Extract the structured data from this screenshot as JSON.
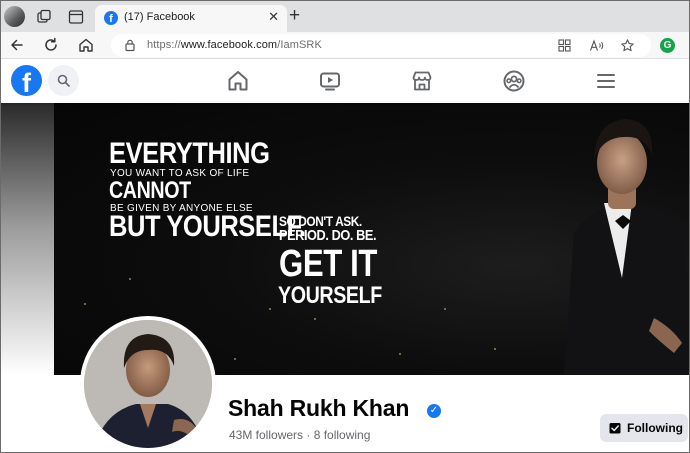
{
  "browser": {
    "tab": {
      "title": "(17) Facebook",
      "favicon": "f",
      "close": "✕"
    },
    "new_tab": "+",
    "address": {
      "url_prefix": "https://",
      "url_host": "www.facebook.com",
      "url_path": "/IamSRK"
    },
    "extension_badge": "G"
  },
  "facebook": {
    "logo": "f",
    "nav_icons": [
      "home-icon",
      "watch-icon",
      "marketplace-icon",
      "groups-icon",
      "menu-icon"
    ]
  },
  "cover": {
    "lines": {
      "l1": "EVERYTHING",
      "l2": "YOU WANT TO ASK OF LIFE",
      "l3": "CANNOT",
      "l4": "BE GIVEN BY ANYONE ELSE",
      "l5": "BUT YOURSELF.",
      "l6": "SO DON'T ASK.",
      "l7": "PERIOD. DO. BE.",
      "l8": "GET IT",
      "l9": "YOURSELF"
    }
  },
  "profile": {
    "name": "Shah Rukh Khan",
    "verified": "✓",
    "followers_text": "43M followers · 8 following",
    "following_button": "Following"
  },
  "colors": {
    "facebook_blue": "#1877f2",
    "tabstrip": "#dfe0e2",
    "button_grey": "#e4e6eb"
  }
}
